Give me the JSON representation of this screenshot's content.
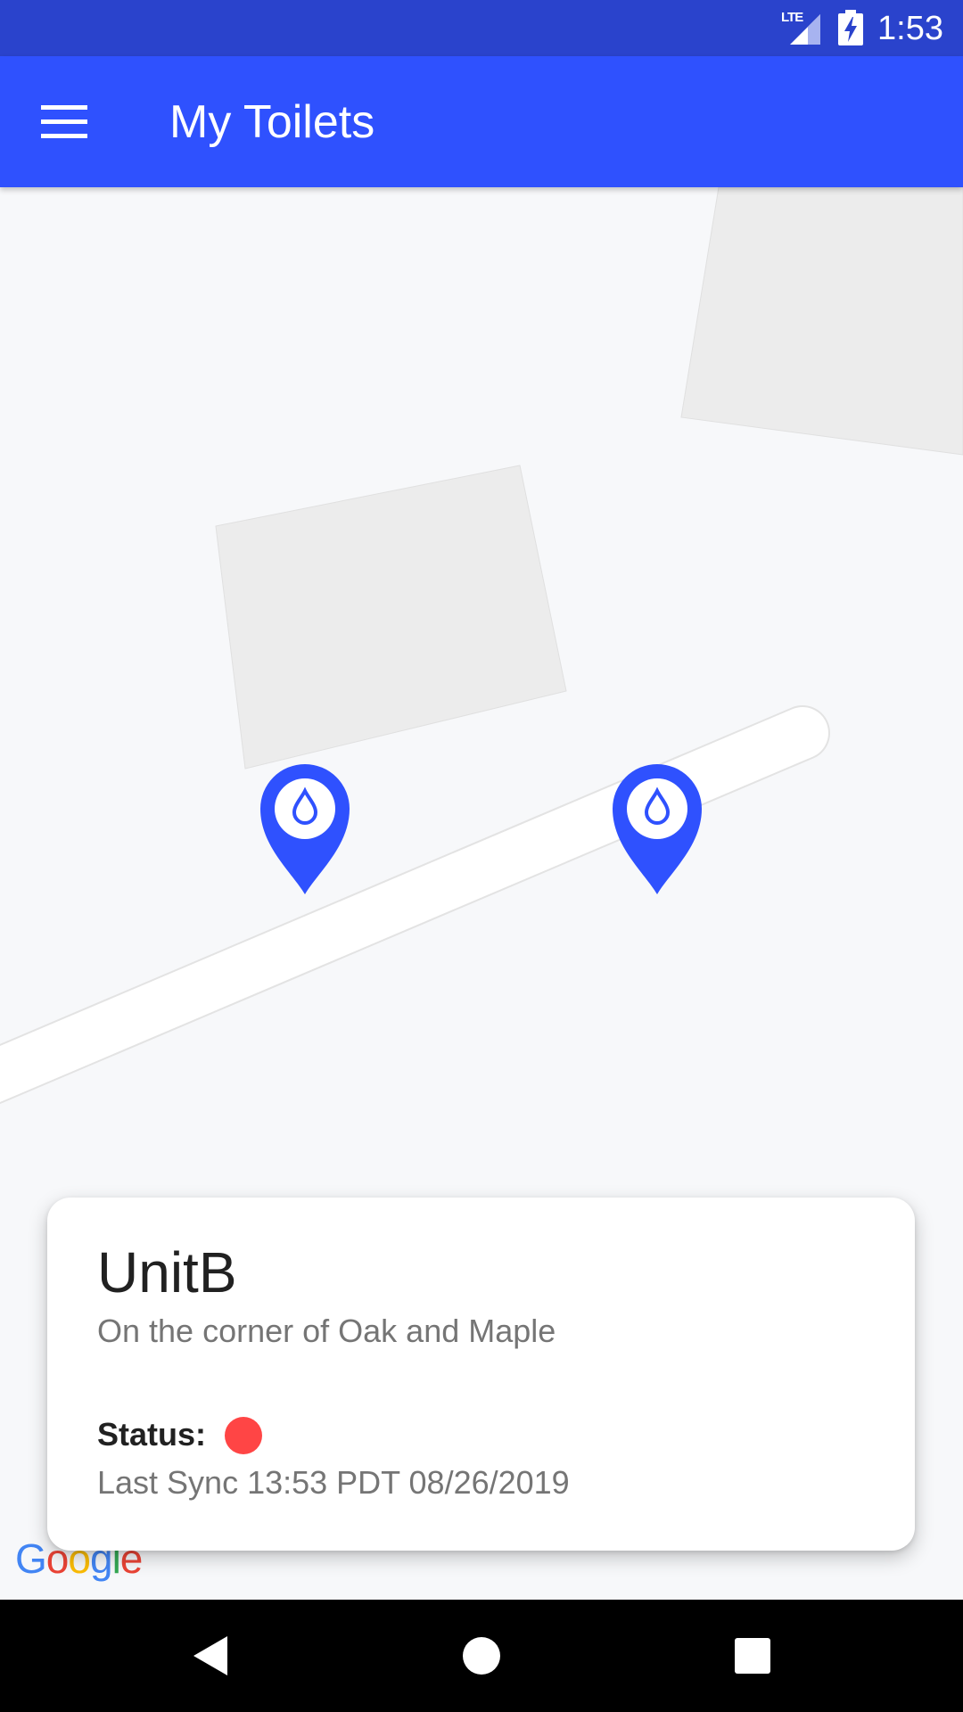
{
  "status_bar": {
    "network": "LTE",
    "time": "1:53"
  },
  "app_bar": {
    "title": "My Toilets",
    "menu_icon": "hamburger-menu-icon"
  },
  "map": {
    "markers": [
      {
        "icon": "water-drop-location-pin-icon"
      },
      {
        "icon": "water-drop-location-pin-icon"
      }
    ],
    "attribution": "Google"
  },
  "card": {
    "name": "UnitB",
    "address": "On the corner of Oak and Maple",
    "status_label": "Status:",
    "status_color": "#ff4545",
    "last_sync": "Last Sync 13:53 PDT 08/26/2019"
  },
  "nav_bar": {
    "back_icon": "back-triangle-icon",
    "home_icon": "home-circle-icon",
    "recents_icon": "recents-square-icon"
  },
  "colors": {
    "status_bar": "#2a43cc",
    "app_bar": "#2f51fe",
    "marker": "#2f51fe"
  }
}
